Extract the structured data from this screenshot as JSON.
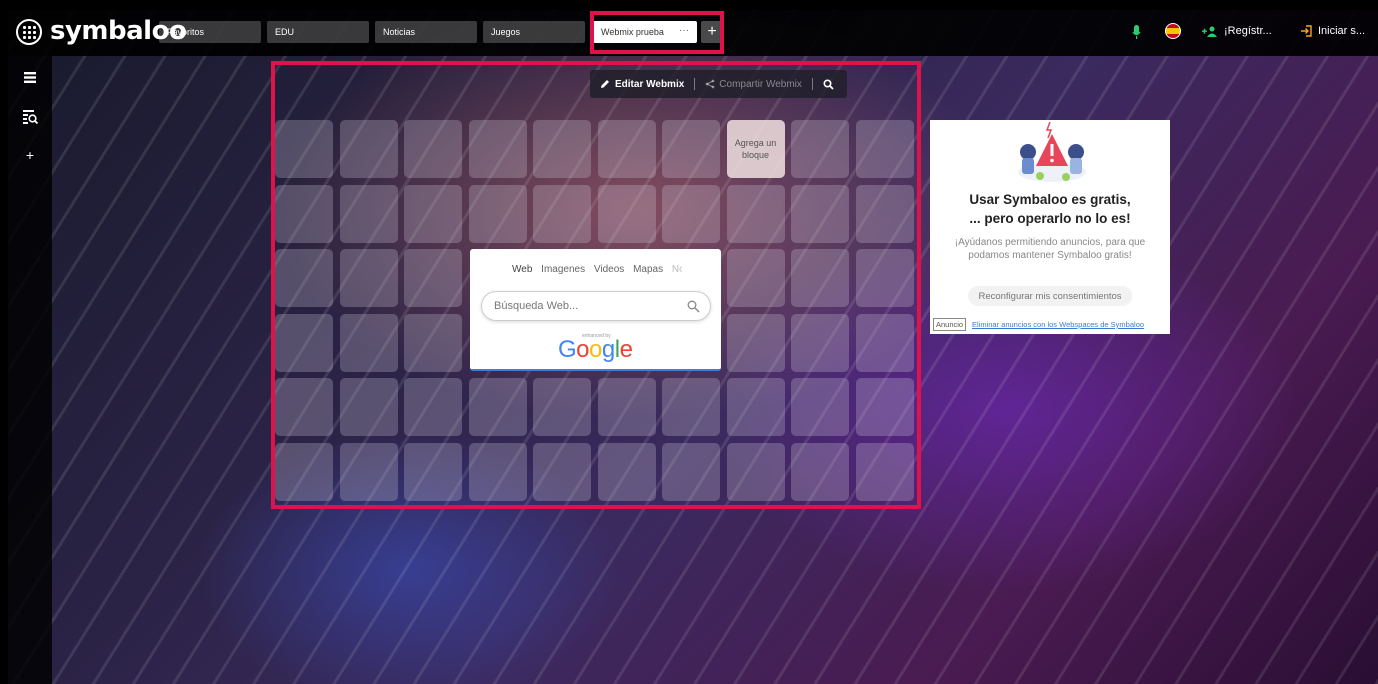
{
  "topbar": {
    "logo": "symbaloo",
    "tabs": [
      {
        "label": "Favoritos"
      },
      {
        "label": "EDU"
      },
      {
        "label": "Noticias"
      },
      {
        "label": "Juegos"
      }
    ],
    "active_tab": {
      "label": "Webmix prueba",
      "menu": "···"
    },
    "add_tab": "+",
    "register_label": "¡Regístr...",
    "login_label": "Iniciar s...",
    "colors": {
      "highlight": "#e0124c",
      "accent_green": "#2ecc71",
      "accent_orange": "#f5a623"
    }
  },
  "sidebar": {
    "icons": [
      "menu-icon",
      "search-list-icon",
      "plus-icon"
    ],
    "add": "+"
  },
  "webmix_toolbar": {
    "edit_label": "Editar Webmix",
    "share_label": "Compartir Webmix"
  },
  "tiles": {
    "add_block_label": "Agrega un bloque"
  },
  "search_widget": {
    "tabs": [
      "Web",
      "Imagenes",
      "Videos",
      "Mapas",
      "No"
    ],
    "active_tab": "Web",
    "placeholder": "Búsqueda Web...",
    "enhanced_by": "enhanced by",
    "brand": "Google"
  },
  "ad": {
    "title_line1": "Usar Symbaloo es gratis,",
    "title_line2": "... pero operarlo no lo es!",
    "body": "¡Ayúdanos permitiendo anuncios, para que podamos mantener Symbaloo gratis!",
    "button": "Reconfigurar mis consentimientos",
    "label": "Anuncio",
    "link": "Eliminar anuncios con los Webspaces de Symbaloo"
  }
}
